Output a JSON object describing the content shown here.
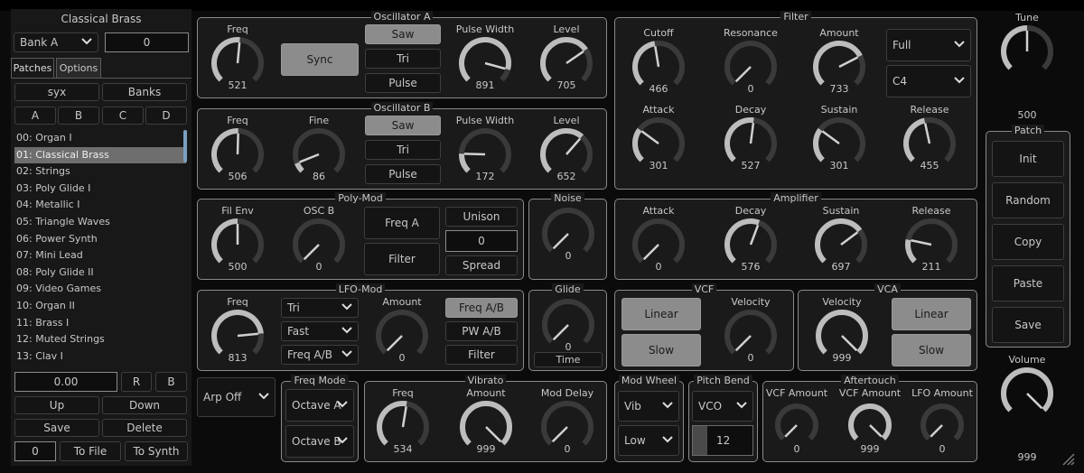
{
  "left": {
    "title": "Classical Brass",
    "bank_select": "Bank A",
    "bank_number": "0",
    "tabs": [
      "Patches",
      "Options"
    ],
    "syx": "syx",
    "banks": "Banks",
    "letters": [
      "A",
      "B",
      "C",
      "D"
    ],
    "patches": [
      "00: Organ I",
      "01: Classical Brass",
      "02: Strings",
      "03: Poly Glide I",
      "04: Metallic I",
      "05: Triangle Waves",
      "06: Power Synth",
      "07: Mini Lead",
      "08: Poly Glide II",
      "09: Video Games",
      "10: Organ II",
      "11: Brass I",
      "12: Muted Strings",
      "13: Clav I"
    ],
    "selected_index": 1,
    "value_field": "0.00",
    "r": "R",
    "b": "B",
    "up": "Up",
    "down": "Down",
    "save": "Save",
    "delete": "Delete",
    "file_num": "0",
    "to_file": "To File",
    "to_synth": "To Synth"
  },
  "oscA": {
    "title": "Oscillator A",
    "freq_label": "Freq",
    "freq_val": "521",
    "freq_pos": 0.52,
    "sync": "Sync",
    "waves": [
      "Saw",
      "Tri",
      "Pulse"
    ],
    "pw_label": "Pulse Width",
    "pw_val": "891",
    "pw_pos": 0.89,
    "level_label": "Level",
    "level_val": "705",
    "level_pos": 0.705
  },
  "oscB": {
    "title": "Oscillator B",
    "freq_label": "Freq",
    "freq_val": "506",
    "freq_pos": 0.506,
    "fine_label": "Fine",
    "fine_val": "86",
    "fine_pos": 0.086,
    "waves": [
      "Saw",
      "Tri",
      "Pulse"
    ],
    "pw_label": "Pulse Width",
    "pw_val": "172",
    "pw_pos": 0.172,
    "level_label": "Level",
    "level_val": "652",
    "level_pos": 0.652
  },
  "filter": {
    "title": "Filter",
    "cutoff_label": "Cutoff",
    "cutoff_val": "466",
    "cutoff_pos": 0.466,
    "res_label": "Resonance",
    "res_val": "0",
    "res_pos": 0,
    "amount_label": "Amount",
    "amount_val": "733",
    "amount_pos": 0.733,
    "mode": "Full",
    "note": "C4",
    "attack_label": "Attack",
    "attack_val": "301",
    "attack_pos": 0.301,
    "decay_label": "Decay",
    "decay_val": "527",
    "decay_pos": 0.527,
    "sustain_label": "Sustain",
    "sustain_val": "301",
    "sustain_pos": 0.301,
    "release_label": "Release",
    "release_val": "455",
    "release_pos": 0.455
  },
  "tune": {
    "label": "Tune",
    "val": "500",
    "pos": 0.5
  },
  "patch": {
    "title": "Patch",
    "buttons": [
      "Init",
      "Random",
      "Copy",
      "Paste",
      "Save"
    ]
  },
  "volume": {
    "label": "Volume",
    "val": "999",
    "pos": 0.999
  },
  "polymod": {
    "title": "Poly-Mod",
    "filenv_label": "Fil Env",
    "filenv_val": "500",
    "filenv_pos": 0.5,
    "oscb_label": "OSC B",
    "oscb_val": "0",
    "oscb_pos": 0,
    "freqa": "Freq A",
    "filter": "Filter",
    "unison": "Unison",
    "unison_val": "0",
    "spread": "Spread"
  },
  "noise": {
    "title": "Noise",
    "val": "0",
    "pos": 0
  },
  "amplifier": {
    "title": "Amplifier",
    "attack_label": "Attack",
    "attack_val": "0",
    "attack_pos": 0,
    "decay_label": "Decay",
    "decay_val": "576",
    "decay_pos": 0.576,
    "sustain_label": "Sustain",
    "sustain_val": "697",
    "sustain_pos": 0.697,
    "release_label": "Release",
    "release_val": "211",
    "release_pos": 0.211
  },
  "lfo": {
    "title": "LFO-Mod",
    "freq_label": "Freq",
    "freq_val": "813",
    "freq_pos": 0.813,
    "wave": "Tri",
    "speed": "Fast",
    "target": "Freq A/B",
    "amount_label": "Amount",
    "amount_val": "0",
    "amount_pos": 0,
    "dest": [
      "Freq A/B",
      "PW A/B",
      "Filter"
    ]
  },
  "glide": {
    "title": "Glide",
    "val": "0",
    "pos": 0,
    "time": "Time"
  },
  "vcf": {
    "title": "VCF",
    "linear": "Linear",
    "slow": "Slow",
    "vel_label": "Velocity",
    "vel_val": "0",
    "vel_pos": 0
  },
  "vca": {
    "title": "VCA",
    "vel_label": "Velocity",
    "vel_val": "999",
    "vel_pos": 0.999,
    "linear": "Linear",
    "slow": "Slow"
  },
  "arp": {
    "value": "Arp Off"
  },
  "freqmode": {
    "title": "Freq Mode",
    "a": "Octave A",
    "b": "Octave B"
  },
  "vibrato": {
    "title": "Vibrato",
    "freq_label": "Freq",
    "freq_val": "534",
    "freq_pos": 0.534,
    "amount_label": "Amount",
    "amount_val": "999",
    "amount_pos": 0.999,
    "delay_label": "Mod Delay",
    "delay_val": "0",
    "delay_pos": 0
  },
  "modwheel": {
    "title": "Mod Wheel",
    "dest": "Vib",
    "range": "Low"
  },
  "pitchbend": {
    "title": "Pitch Bend",
    "dest": "VCO",
    "amount": "12"
  },
  "aftertouch": {
    "title": "Aftertouch",
    "vcf_label": "VCF Amount",
    "vcf_val": "0",
    "vcf_pos": 0,
    "vcfamt_label": "VCF Amount",
    "vcfamt_val": "999",
    "vcfamt_pos": 0.999,
    "lfo_label": "LFO Amount",
    "lfo_val": "0",
    "lfo_pos": 0
  },
  "colors": {
    "bg": "#1a1a1a",
    "arc": "#bdbdbd",
    "track": "#3a3a3a",
    "on": "#8c8c8c"
  }
}
